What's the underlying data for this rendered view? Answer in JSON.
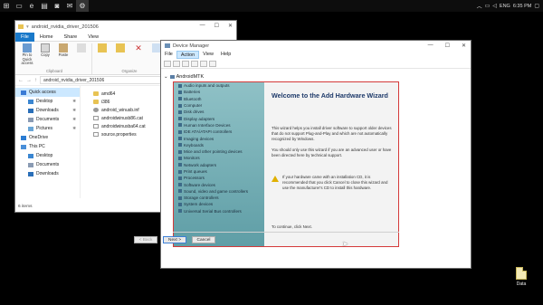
{
  "taskbar": {
    "items": [
      {
        "name": "start-button",
        "glyph": "⊞"
      },
      {
        "name": "task-view-button",
        "glyph": "▭"
      },
      {
        "name": "edge-button",
        "glyph": "e"
      },
      {
        "name": "explorer-button",
        "glyph": "▤"
      },
      {
        "name": "store-button",
        "glyph": "◙"
      },
      {
        "name": "mail-button",
        "glyph": "✉"
      },
      {
        "name": "devmgr-button",
        "glyph": "⚙"
      }
    ],
    "tray": {
      "lang": "ENG",
      "time": "6:35 PM"
    }
  },
  "desktop": {
    "icon_label": "Data"
  },
  "explorer": {
    "title": "android_nvidia_driver_201506",
    "tabs": [
      "File",
      "Home",
      "Share",
      "View"
    ],
    "ribbon": {
      "clipboard": {
        "label": "Clipboard",
        "buttons": [
          "Pin to Quick access",
          "Copy",
          "Paste"
        ]
      },
      "organize": {
        "label": "Organize",
        "buttons": [
          "",
          ""
        ]
      },
      "new": {
        "label": "New",
        "buttons": [
          "New folder"
        ]
      }
    },
    "address": "android_nvidia_driver_201506",
    "nav": [
      {
        "label": "Quick access",
        "sel": true,
        "sub": false
      },
      {
        "label": "Desktop",
        "sel": false,
        "sub": true,
        "pin": "✱"
      },
      {
        "label": "Downloads",
        "sel": false,
        "sub": true,
        "pin": "✱"
      },
      {
        "label": "Documents",
        "sel": false,
        "sub": true,
        "pin": "✱"
      },
      {
        "label": "Pictures",
        "sel": false,
        "sub": true,
        "pin": "✱"
      },
      {
        "label": "OneDrive",
        "sel": false,
        "sub": false
      },
      {
        "label": "This PC",
        "sel": false,
        "sub": false
      },
      {
        "label": "Desktop",
        "sel": false,
        "sub": true
      },
      {
        "label": "Documents",
        "sel": false,
        "sub": true
      },
      {
        "label": "Downloads",
        "sel": false,
        "sub": true
      }
    ],
    "files": [
      {
        "name": "amd64",
        "icon": "folder"
      },
      {
        "name": "i386",
        "icon": "folder"
      },
      {
        "name": "android_winusb.inf",
        "icon": "gear"
      },
      {
        "name": "androidwinusb86.cat",
        "icon": "doc"
      },
      {
        "name": "androidwinusba64.cat",
        "icon": "doc"
      },
      {
        "name": "source.properties",
        "icon": "doc"
      }
    ],
    "status": "6 items"
  },
  "devmgr": {
    "title": "Device Manager",
    "menu": [
      "File",
      "Action",
      "View",
      "Help"
    ],
    "menu_active": "Action",
    "root": "AndroidMTK"
  },
  "wizard": {
    "categories": [
      "Audio inputs and outputs",
      "Batteries",
      "Bluetooth",
      "Computer",
      "Disk drives",
      "Display adapters",
      "Human Interface Devices",
      "IDE ATA/ATAPI controllers",
      "Imaging devices",
      "Keyboards",
      "Mice and other pointing devices",
      "Monitors",
      "Network adapters",
      "Print queues",
      "Processors",
      "Software devices",
      "Sound, video and game controllers",
      "Storage controllers",
      "System devices",
      "Universal Serial Bus controllers"
    ],
    "title": "Welcome to the Add Hardware Wizard",
    "p1": "This wizard helps you install driver software to support older devices that do not support Plug-and-Play and which are not automatically recognized by Windows.",
    "p2": "You should only use this wizard if you are an advanced user or have been directed here by technical support.",
    "warning": "If your hardware came with an installation CD, it is recommended that you click Cancel to close this wizard and use the manufacturer's CD to install this hardware.",
    "p3": "To continue, click Next.",
    "back": "< Back",
    "next": "Next >",
    "cancel": "Cancel"
  }
}
